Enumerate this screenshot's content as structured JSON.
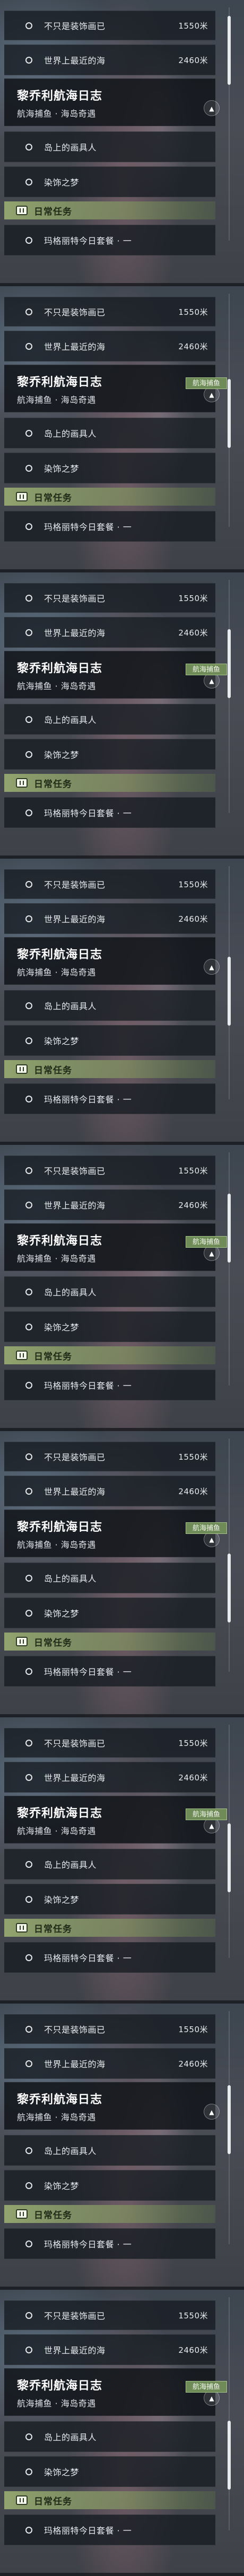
{
  "rows": {
    "item1": {
      "label": "不只是装饰画已",
      "distance": "1550米"
    },
    "item2": {
      "label": "世界上最近的海",
      "distance": "2460米"
    }
  },
  "quest": {
    "title": "黎乔利航海日志",
    "subtitle": "航海捕鱼 · 海岛奇遇",
    "tag": "航海捕鱼",
    "items": [
      "岛上的画具人",
      "染饰之梦"
    ]
  },
  "daily": {
    "label": "日常任务",
    "item": "玛格丽特今日套餐 · 一"
  },
  "colors": {
    "daily_bar": "#a8be78",
    "tag_bg": "#6f8c58",
    "panel_bg": "#161b21"
  },
  "icons": [
    "circle-icon",
    "chevron-up-icon",
    "daily-task-icon",
    "scrollbar"
  ],
  "strips": [
    {
      "show_tag": false,
      "thumb_pos": 0.05
    },
    {
      "show_tag": true,
      "thumb_pos": 0.52
    },
    {
      "show_tag": true,
      "thumb_pos": 0.3
    },
    {
      "show_tag": false,
      "thumb_pos": 0.55
    },
    {
      "show_tag": true,
      "thumb_pos": 0.25
    },
    {
      "show_tag": true,
      "thumb_pos": 0.7
    },
    {
      "show_tag": true,
      "thumb_pos": 0.6
    },
    {
      "show_tag": false,
      "thumb_pos": 0.45
    },
    {
      "show_tag": true,
      "thumb_pos": 0.75
    }
  ]
}
